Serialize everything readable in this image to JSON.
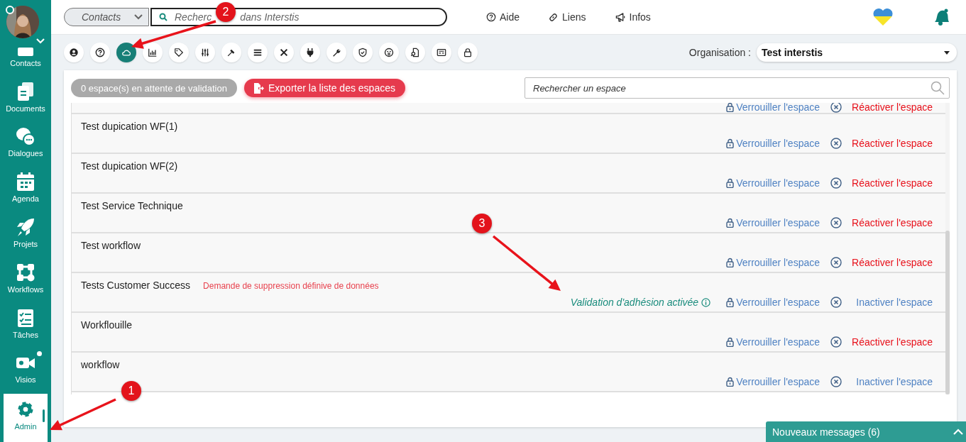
{
  "sidebar": {
    "items": [
      {
        "label": "Contacts",
        "selected": false,
        "badge": false
      },
      {
        "label": "Documents",
        "selected": false,
        "badge": false
      },
      {
        "label": "Dialogues",
        "selected": false,
        "badge": false
      },
      {
        "label": "Agenda",
        "selected": false,
        "badge": false
      },
      {
        "label": "Projets",
        "selected": false,
        "badge": false
      },
      {
        "label": "Workflows",
        "selected": false,
        "badge": false
      },
      {
        "label": "Tâches",
        "selected": false,
        "badge": false
      },
      {
        "label": "Visios",
        "selected": false,
        "badge": true
      },
      {
        "label": "Admin",
        "selected": true,
        "badge": false
      }
    ]
  },
  "topbar": {
    "scope": "Contacts",
    "search": {
      "placeholder_parts": [
        "Recherc",
        "dans Interstis"
      ]
    },
    "links": [
      "Aide",
      "Liens",
      "Infos"
    ]
  },
  "toolbar": {
    "icons": [
      {
        "selected": false
      },
      {
        "selected": false
      },
      {
        "selected": true
      },
      {
        "selected": false
      },
      {
        "selected": false
      },
      {
        "selected": false
      },
      {
        "selected": false
      },
      {
        "selected": false
      },
      {
        "selected": false
      },
      {
        "selected": false
      },
      {
        "selected": false
      },
      {
        "selected": false
      },
      {
        "selected": false
      },
      {
        "selected": false
      },
      {
        "selected": false
      },
      {
        "selected": false
      }
    ],
    "organisation": {
      "label": "Organisation :",
      "value": "Test interstis"
    }
  },
  "panel": {
    "pending_button": {
      "label": "0 espace(s) en attente de validation",
      "disabled": true
    },
    "export_button": "Exporter la liste des espaces",
    "search": {
      "placeholder": "Rechercher un espace"
    },
    "spaces": [
      {
        "lock": "Verrouiller l'espace",
        "action": {
          "label": "Réactiver l'espace",
          "kind": "reactivate"
        }
      },
      {
        "name": "Test dupication WF(1)",
        "lock": "Verrouiller l'espace",
        "action": {
          "label": "Réactiver l'espace",
          "kind": "reactivate"
        }
      },
      {
        "name": "Test dupication WF(2)",
        "lock": "Verrouiller l'espace",
        "action": {
          "label": "Réactiver l'espace",
          "kind": "reactivate"
        }
      },
      {
        "name": "Test Service Technique",
        "lock": "Verrouiller l'espace",
        "action": {
          "label": "Réactiver l'espace",
          "kind": "reactivate"
        }
      },
      {
        "name": "Test workflow",
        "lock": "Verrouiller l'espace",
        "action": {
          "label": "Réactiver l'espace",
          "kind": "reactivate"
        }
      },
      {
        "name": "Tests Customer Success",
        "note": "Demande de suppression définive de données",
        "validation": "Validation d'adhésion activée",
        "lock": "Verrouiller l'espace",
        "action": {
          "label": "Inactiver l'espace",
          "kind": "deactivate"
        }
      },
      {
        "name": "Workflouille",
        "lock": "Verrouiller l'espace",
        "action": {
          "label": "Réactiver l'espace",
          "kind": "reactivate"
        }
      },
      {
        "name": "workflow",
        "lock": "Verrouiller l'espace",
        "action": {
          "label": "Inactiver l'espace",
          "kind": "deactivate"
        }
      }
    ]
  },
  "chat_bar": {
    "label": "Nouveaux messages (6)"
  },
  "annotations": [
    "1",
    "2",
    "3"
  ]
}
